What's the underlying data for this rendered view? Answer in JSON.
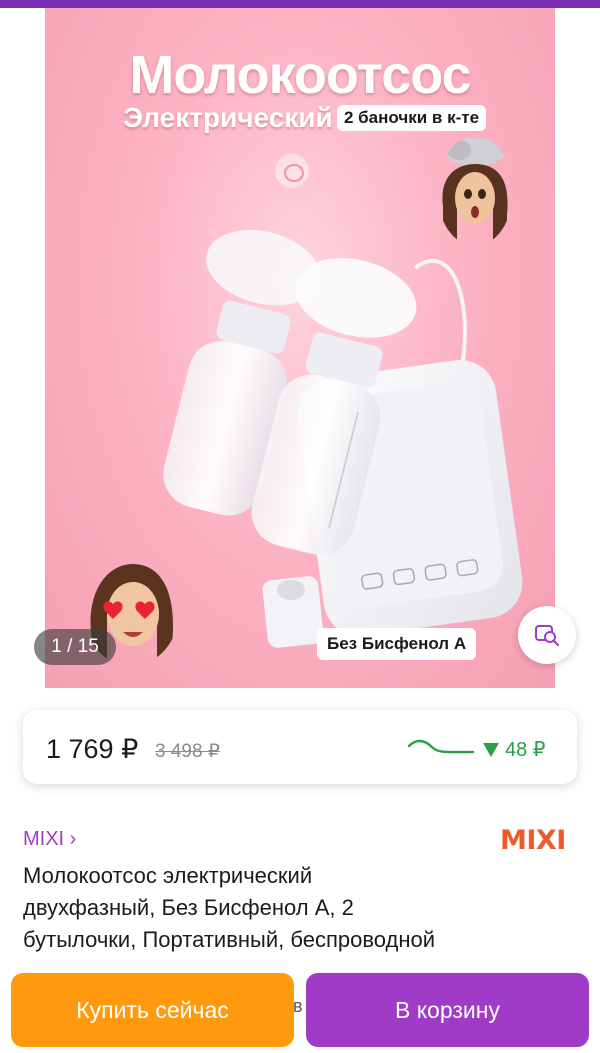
{
  "colors": {
    "accent_purple": "#7b2fb6",
    "brand_link": "#a23db8",
    "buy_now": "#ff9a0e",
    "add_to_cart": "#a03bc8",
    "price_drop": "#27a046",
    "brand_logo": "#f05a2a"
  },
  "gallery": {
    "banner_title": "Молокоотсос",
    "banner_subtitle": "Электрический",
    "banner_badge": "2 баночки в к-те",
    "feature_badge": "Без Бисфенол А",
    "counter": "1 / 15",
    "icons": {
      "visual_search": "image-search-icon",
      "baby": "baby-face-icon"
    }
  },
  "price": {
    "current": "1 769 ₽",
    "old": "3 498 ₽",
    "drop": "48 ₽",
    "drop_icon": "down-triangle-icon",
    "trend_icon": "price-trend-line-icon"
  },
  "product": {
    "brand": "MIXI ›",
    "brand_logo": "MIXI",
    "title": "Молокоотсос электрический двухфазный, Без Бисфенол А, 2 бутылочки, Портативный, беспроводной",
    "partial_text": "в"
  },
  "actions": {
    "buy_now": "Купить сейчас",
    "add_to_cart": "В корзину"
  }
}
